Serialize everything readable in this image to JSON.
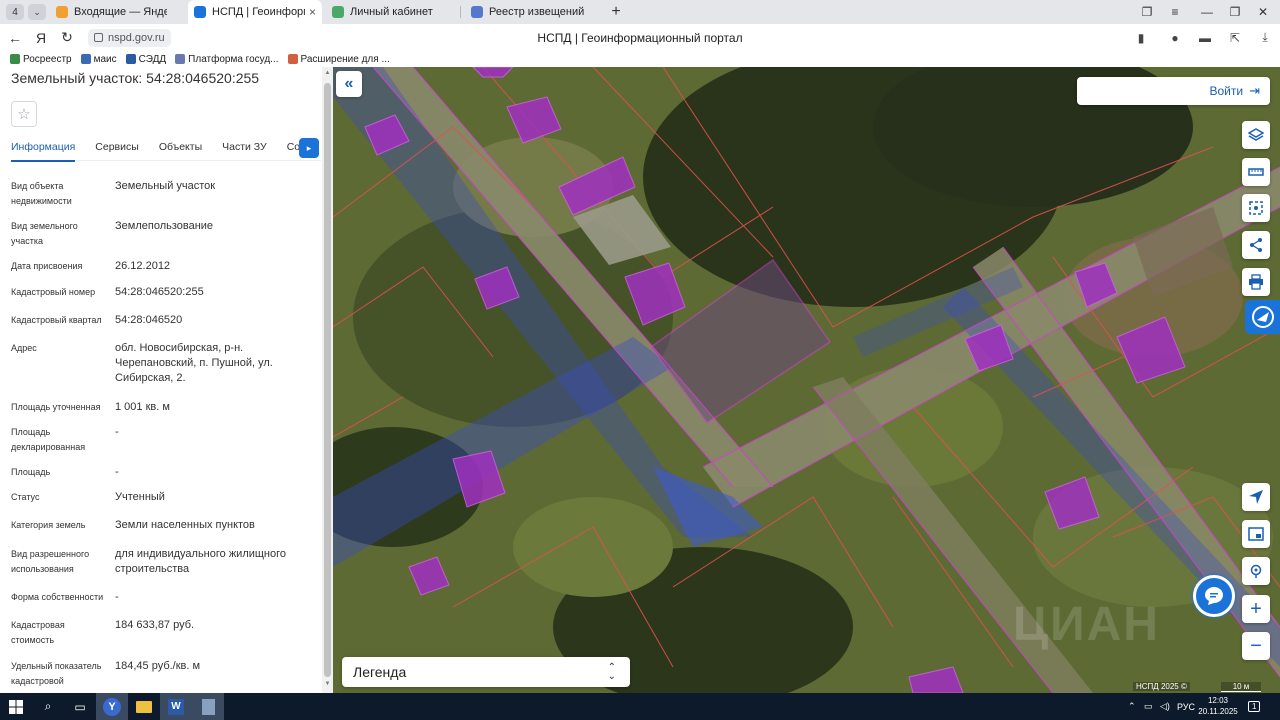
{
  "browser": {
    "tab_counter": "4",
    "tabs": [
      {
        "label": "Входящие — Яндекс Почт",
        "active": false,
        "color": "#f0a030"
      },
      {
        "label": "НСПД | Геоинформацио",
        "active": true,
        "color": "#1a73d9"
      },
      {
        "label": "Личный кабинет",
        "active": false,
        "color": "#4aa86a"
      },
      {
        "label": "Реестр извещений",
        "active": false,
        "color": "#5577cc"
      }
    ],
    "url": "nspd.gov.ru",
    "page_title": "НСПД | Геоинформационный портал",
    "bookmarks": [
      {
        "label": "Росреестр",
        "color": "#3a8a4a"
      },
      {
        "label": "маис",
        "color": "#3a6ab0"
      },
      {
        "label": "СЭДД",
        "color": "#2a5aa0"
      },
      {
        "label": "Платформа госуд...",
        "color": "#6a7ab0"
      },
      {
        "label": "Расширение для ...",
        "color": "#d06040"
      }
    ]
  },
  "panel": {
    "title": "Земельный участок: 54:28:046520:255",
    "tabs": [
      "Информация",
      "Сервисы",
      "Объекты",
      "Части ЗУ",
      "Соста"
    ],
    "active_tab": "Информация",
    "fields": [
      {
        "key": "Вид объекта недвижимости",
        "value": "Земельный участок"
      },
      {
        "key": "Вид земельного участка",
        "value": "Землепользование"
      },
      {
        "key": "Дата присвоения",
        "value": "26.12.2012"
      },
      {
        "key": "Кадастровый номер",
        "value": "54:28:046520:255"
      },
      {
        "key": "Кадастровый квартал",
        "value": "54:28:046520"
      },
      {
        "key": "Адрес",
        "value": "обл. Новосибирская, р-н. Черепановский, п. Пушной, ул. Сибирская, 2."
      },
      {
        "key": "Площадь уточненная",
        "value": "1 001 кв. м"
      },
      {
        "key": "Площадь декларированная",
        "value": "-"
      },
      {
        "key": "Площадь",
        "value": "-"
      },
      {
        "key": "Статус",
        "value": "Учтенный"
      },
      {
        "key": "Категория земель",
        "value": "Земли населенных пунктов"
      },
      {
        "key": "Вид разрешенного использования",
        "value": "для индивидуального жилищного строительства"
      },
      {
        "key": "Форма собственности",
        "value": "-"
      },
      {
        "key": "Кадастровая стоимость",
        "value": "184 633,87 руб."
      },
      {
        "key": "Удельный показатель кадастровой",
        "value": "184,45 руб./кв. м"
      }
    ]
  },
  "map": {
    "login_label": "Войти",
    "legend_label": "Легенда",
    "copyright": "НСПД 2025 ©",
    "scale": "10 м",
    "watermark": "ЦИАН",
    "tools": [
      "layers-icon",
      "ruler-icon",
      "select-area-icon",
      "share-icon",
      "print-icon"
    ],
    "bottom_tools": [
      "navigate-icon",
      "picture-in-picture-icon",
      "locate-icon",
      "zoom-in-icon",
      "zoom-out-icon"
    ]
  },
  "taskbar": {
    "lang": "РУС",
    "time": "12:03",
    "date": "20.11.2025",
    "notifications": "1"
  }
}
